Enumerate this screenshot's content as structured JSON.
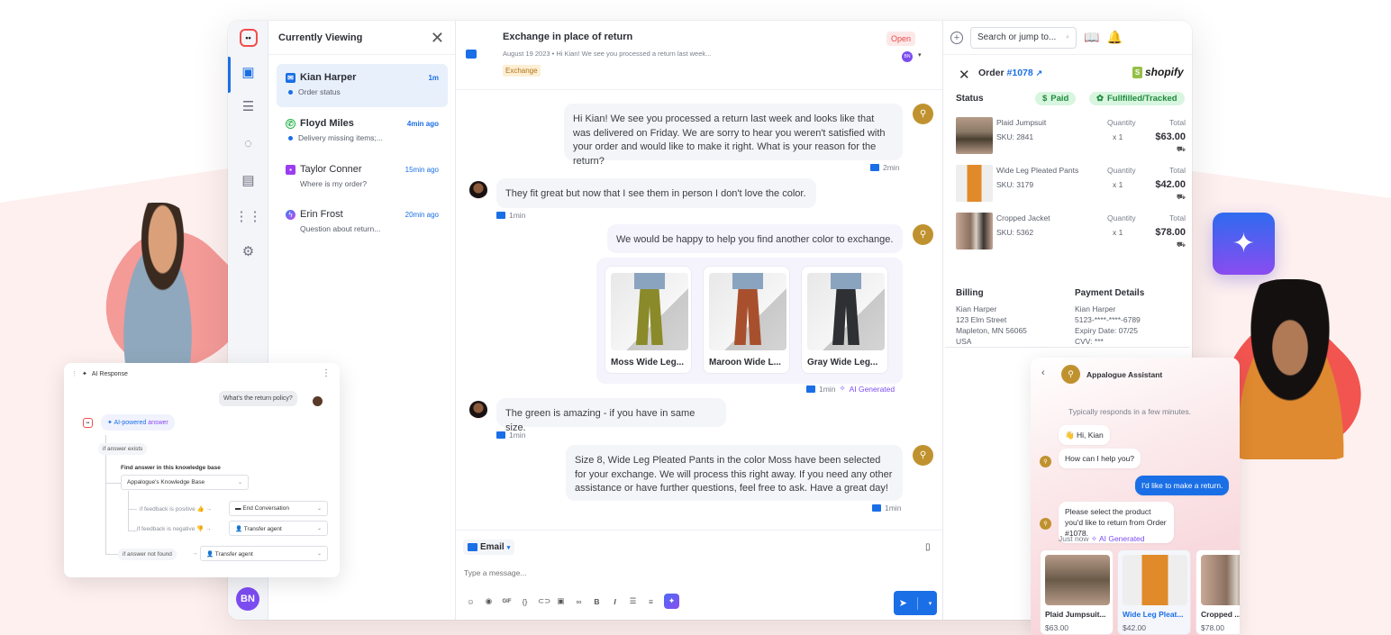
{
  "rail": {
    "items": [
      {
        "icon": "inbox-icon",
        "active": true
      },
      {
        "icon": "search-list-icon"
      },
      {
        "icon": "reports-icon"
      },
      {
        "icon": "activity-icon"
      },
      {
        "icon": "apps-grid-icon"
      },
      {
        "icon": "settings-gear-icon"
      }
    ],
    "user_initials": "BN"
  },
  "conversations": {
    "title": "Currently Viewing",
    "items": [
      {
        "name": "Kian Harper",
        "channel": "email",
        "time": "1m",
        "preview": "Order status",
        "unread": true
      },
      {
        "name": "Floyd Miles",
        "channel": "whatsapp",
        "time": "4min ago",
        "preview": "Delivery missing items;...",
        "unread": true
      },
      {
        "name": "Taylor Conner",
        "channel": "chat",
        "time": "15min ago",
        "preview": "Where is my order?",
        "unread": false
      },
      {
        "name": "Erin Frost",
        "channel": "messenger",
        "time": "20min ago",
        "preview": "Question about return...",
        "unread": false
      }
    ]
  },
  "thread": {
    "subject": "Exchange in place of return",
    "meta": "August 19 2023  •  Hi Kian! We see you processed a return last week...",
    "tag": "Exchange",
    "status": "Open",
    "assignee": "BN",
    "messages": [
      {
        "from": "agent",
        "text": "Hi Kian! We see you processed a return last week and looks like that was delivered on Friday. We are sorry to hear you weren't satisfied with your order and would like to make it right. What is your reason for the return?",
        "time": "2min"
      },
      {
        "from": "customer",
        "text": "They fit great but now that I see them in person I don't love the color.",
        "time": "1min"
      },
      {
        "from": "agent",
        "text": "We would be happy to help you find another color to exchange.",
        "time": "1min",
        "ai_label": "AI Generated"
      },
      {
        "from": "customer",
        "text": "The green is amazing - if you have in same size.",
        "time": "1min"
      },
      {
        "from": "agent",
        "text": "Size 8, Wide Leg Pleated Pants in the color Moss have been selected for your exchange. We will process this right away. If you need any other assistance or have further questions, feel free to ask. Have a great day!",
        "time": "1min"
      }
    ],
    "products": [
      {
        "name": "Moss Wide Leg...",
        "color": "#8a8a2a"
      },
      {
        "name": "Maroon Wide L...",
        "color": "#a8502e"
      },
      {
        "name": "Gray Wide Leg...",
        "color": "#2f3033"
      }
    ]
  },
  "composer": {
    "channel": "Email",
    "placeholder": "Type a message...",
    "tools": [
      "emoji-icon",
      "record-icon",
      "gif-icon",
      "variable-icon",
      "attachment-icon",
      "image-icon",
      "link-icon",
      "bold-icon",
      "italic-icon",
      "ordered-list-icon",
      "bullet-list-icon",
      "ai-assist-icon"
    ]
  },
  "topbar": {
    "search_placeholder": "Search or jump to..."
  },
  "order": {
    "label": "Order",
    "number": "#1078",
    "brand": "shopify",
    "status_label": "Status",
    "badges": [
      "Paid",
      "Fullfilled/Tracked"
    ],
    "qty_header": "Quantity",
    "total_header": "Total",
    "lines": [
      {
        "name": "Plaid Jumpsuit",
        "sku": "SKU: 2841",
        "qty": "x 1",
        "total": "$63.00"
      },
      {
        "name": "Wide Leg Pleated Pants",
        "sku": "SKU: 3179",
        "qty": "x 1",
        "total": "$42.00"
      },
      {
        "name": "Cropped Jacket",
        "sku": "SKU: 5362",
        "qty": "x 1",
        "total": "$78.00"
      }
    ],
    "billing": {
      "title": "Billing",
      "lines": [
        "Kian Harper",
        "123 Elm Street",
        "Mapleton, MN 56065",
        "USA"
      ]
    },
    "payment": {
      "title": "Payment Details",
      "lines": [
        "Kian Harper",
        "5123-****-****-6789",
        "Expiry Date: 07/25",
        "CVV: ***"
      ]
    }
  },
  "ai_response": {
    "title": "AI Response",
    "question": "What's the return policy?",
    "answer_label_1": "AI-powered",
    "answer_label_2": "answer",
    "if_exists": "if answer exists",
    "kb_label": "Find answer in this knowledge base",
    "kb_value": "Appalogue's Knowledge Base",
    "positive_cond": "if feedback is positive 👍 →",
    "positive_action": "End Conversation",
    "negative_cond": "if feedback is negative 👎 →",
    "negative_action": "Transfer agent",
    "not_found": "if answer not found",
    "not_found_action": "Transfer agent"
  },
  "assistant": {
    "name": "Appalogue Assistant",
    "responds": "Typically responds in a few minutes.",
    "messages": [
      {
        "from": "bot",
        "text": "👋 Hi, Kian"
      },
      {
        "from": "bot",
        "text": "How can I help you?"
      },
      {
        "from": "user",
        "text": "I'd like to make a return."
      },
      {
        "from": "bot",
        "text": "Please select the product you'd like to return from Order #1078."
      }
    ],
    "stamp": "Just now",
    "ai_label": "AI Generated",
    "products": [
      {
        "name": "Plaid Jumpsuit...",
        "price": "$63.00"
      },
      {
        "name": "Wide Leg Pleat...",
        "price": "$42.00",
        "highlight": true
      },
      {
        "name": "Cropped ...",
        "price": "$78.00"
      }
    ]
  },
  "colors": {
    "accent": "#1a6fe6",
    "ai_purple": "#7b4cf0",
    "brand_red": "#f04d4d",
    "bot_gold": "#c0922f"
  }
}
